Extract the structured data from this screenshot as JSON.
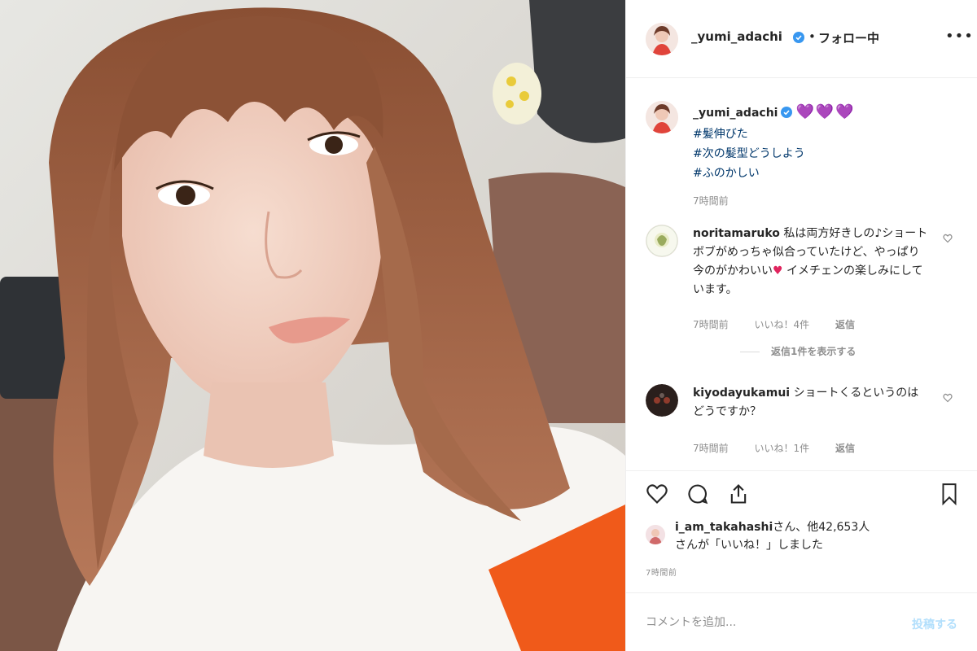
{
  "post": {
    "username": "_yumi_adachi",
    "follow_label": "フォロー中",
    "separator": "•",
    "more_label": "•••"
  },
  "caption": {
    "username": "_yumi_adachi",
    "hearts": "💜💜💜",
    "hashtags": [
      "#髪伸びた",
      "#次の髪型どうしよう",
      "#ふのかしい"
    ],
    "time": "7時間前"
  },
  "comments": [
    {
      "username": "noritamaruko",
      "text": "私は両方好きしの♪ショートボブがめっちゃ似合っていたけど、やっぱり今のがかわいい",
      "text_tail": "イメチェンの楽しみにしています。",
      "time": "7時間前",
      "likes": "いいね！4件",
      "reply": "返信",
      "view_replies": "返信1件を表示する"
    },
    {
      "username": "kiyodayukamui",
      "text": "ショートくるというのはどうですか？",
      "time": "7時間前",
      "likes": "いいね！1件",
      "reply": "返信"
    }
  ],
  "likes_summary": {
    "user": "i_am_takahashi",
    "line1": "さん、他42,653人",
    "line2": "さんが「いいね！」しました"
  },
  "posted_ago": "7時間前",
  "comment_box": {
    "placeholder": "コメントを追加...",
    "post_label": "投稿する"
  },
  "colors": {
    "link": "#00376b",
    "verified": "#3897f0",
    "hearts": "#7b4fd6",
    "post_disabled": "#b2dffc"
  },
  "icons": [
    "verified-icon",
    "more-icon",
    "heart-outline-icon",
    "comment-icon",
    "share-icon",
    "bookmark-icon",
    "red-heart-emoji"
  ]
}
